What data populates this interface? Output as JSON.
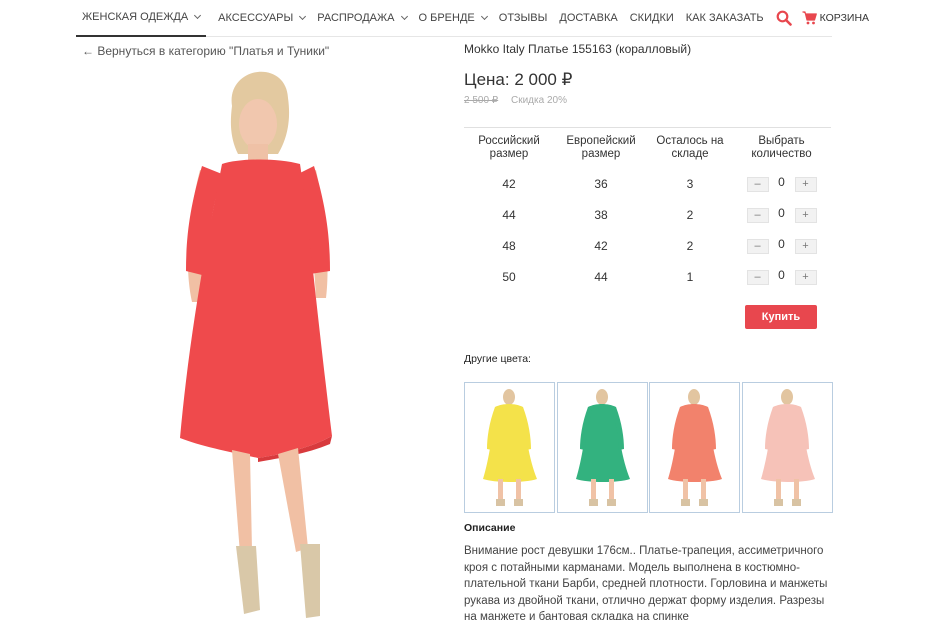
{
  "nav": {
    "items": [
      {
        "label": "ЖЕНСКАЯ ОДЕЖДА",
        "dropdown": true,
        "active": true
      },
      {
        "label": "АКСЕССУАРЫ",
        "dropdown": true
      },
      {
        "label": "РАСПРОДАЖА",
        "dropdown": true
      },
      {
        "label": "О БРЕНДЕ",
        "dropdown": true
      },
      {
        "label": "ОТЗЫВЫ"
      },
      {
        "label": "ДОСТАВКА"
      },
      {
        "label": "СКИДКИ"
      },
      {
        "label": "КАК ЗАКАЗАТЬ"
      }
    ],
    "cart_label": "КОРЗИНА",
    "icons": {
      "search": "search-icon",
      "cart": "cart-icon"
    },
    "accent_color": "#e8474e"
  },
  "back_link": "← Вернуться в категорию \"Платья и Туники\"",
  "product": {
    "title": "Mokko Italy Платье 155163 (коралловый)",
    "price": "Цена: 2 000 ₽",
    "old_price": "2 500 ₽",
    "discount": "Скидка 20%",
    "color_hex": "#ef4a4c"
  },
  "sizes_table": {
    "headers": [
      "Российский размер",
      "Европейский размер",
      "Осталось на складе",
      "Выбрать количество"
    ],
    "rows": [
      {
        "ru": "42",
        "eu": "36",
        "stock": "3",
        "qty": "0"
      },
      {
        "ru": "44",
        "eu": "38",
        "stock": "2",
        "qty": "0"
      },
      {
        "ru": "48",
        "eu": "42",
        "stock": "2",
        "qty": "0"
      },
      {
        "ru": "50",
        "eu": "44",
        "stock": "1",
        "qty": "0"
      }
    ],
    "minus": "–",
    "plus": "+"
  },
  "buy_button": "Купить",
  "other_colors": {
    "label": "Другие цвета:",
    "swatches": [
      {
        "name": "yellow",
        "color": "#f4e24a"
      },
      {
        "name": "green",
        "color": "#33b27f"
      },
      {
        "name": "salmon",
        "color": "#f2826c"
      },
      {
        "name": "pink",
        "color": "#f6c2b8"
      }
    ]
  },
  "description": {
    "label": "Описание",
    "text": "Внимание рост девушки 176см.. Платье-трапеция, ассиметричного кроя с потайными карманами. Модель выполнена в костюмно-плательной ткани Барби, средней плотности. Горловина и манжеты рукава  из двойной ткани, отлично держат форму изделия. Разрезы на манжете и бантовая складка на спинке"
  }
}
